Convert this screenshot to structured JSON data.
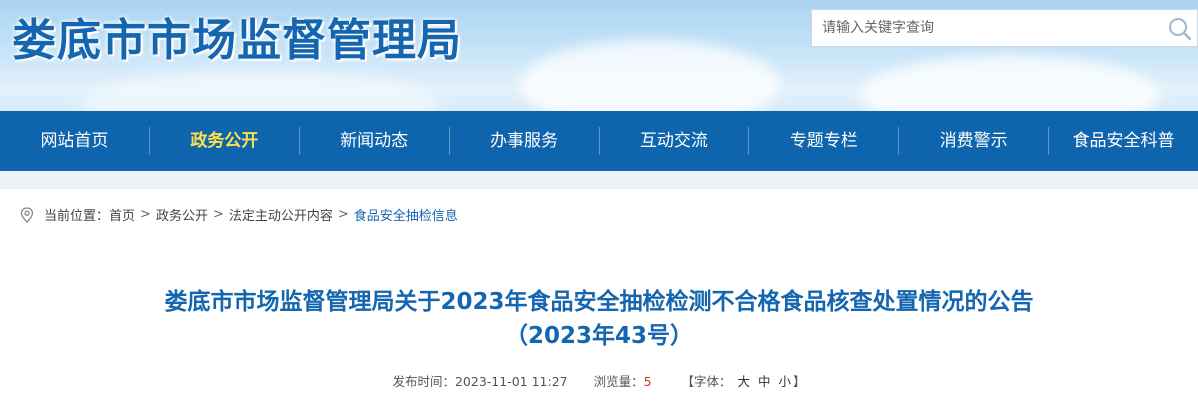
{
  "header": {
    "site_title": "娄底市市场监督管理局",
    "search_placeholder": "请输入关键字查询"
  },
  "nav": {
    "items": [
      {
        "label": "网站首页"
      },
      {
        "label": "政务公开",
        "active": true
      },
      {
        "label": "新闻动态"
      },
      {
        "label": "办事服务"
      },
      {
        "label": "互动交流"
      },
      {
        "label": "专题专栏"
      },
      {
        "label": "消费警示"
      },
      {
        "label": "食品安全科普"
      }
    ]
  },
  "breadcrumb": {
    "prefix": "当前位置：",
    "items": [
      "首页",
      "政务公开",
      "法定主动公开内容",
      "食品安全抽检信息"
    ],
    "separator": ">"
  },
  "article": {
    "title_line1": "娄底市市场监督管理局关于2023年食品安全抽检检测不合格食品核查处置情况的公告",
    "title_line2": "（2023年43号）",
    "publish_label": "发布时间：",
    "publish_time": "2023-11-01 11:27",
    "views_label": "浏览量：",
    "views": "5",
    "font_open": "【字体：",
    "font_large": "大",
    "font_medium": "中",
    "font_small": "小",
    "font_close": "】"
  },
  "colors": {
    "brand_blue": "#1466b0",
    "nav_bg": "#0f65ad",
    "nav_active": "#ffe14a"
  },
  "icons": {
    "search": "search-icon",
    "location": "location-pin-icon"
  }
}
